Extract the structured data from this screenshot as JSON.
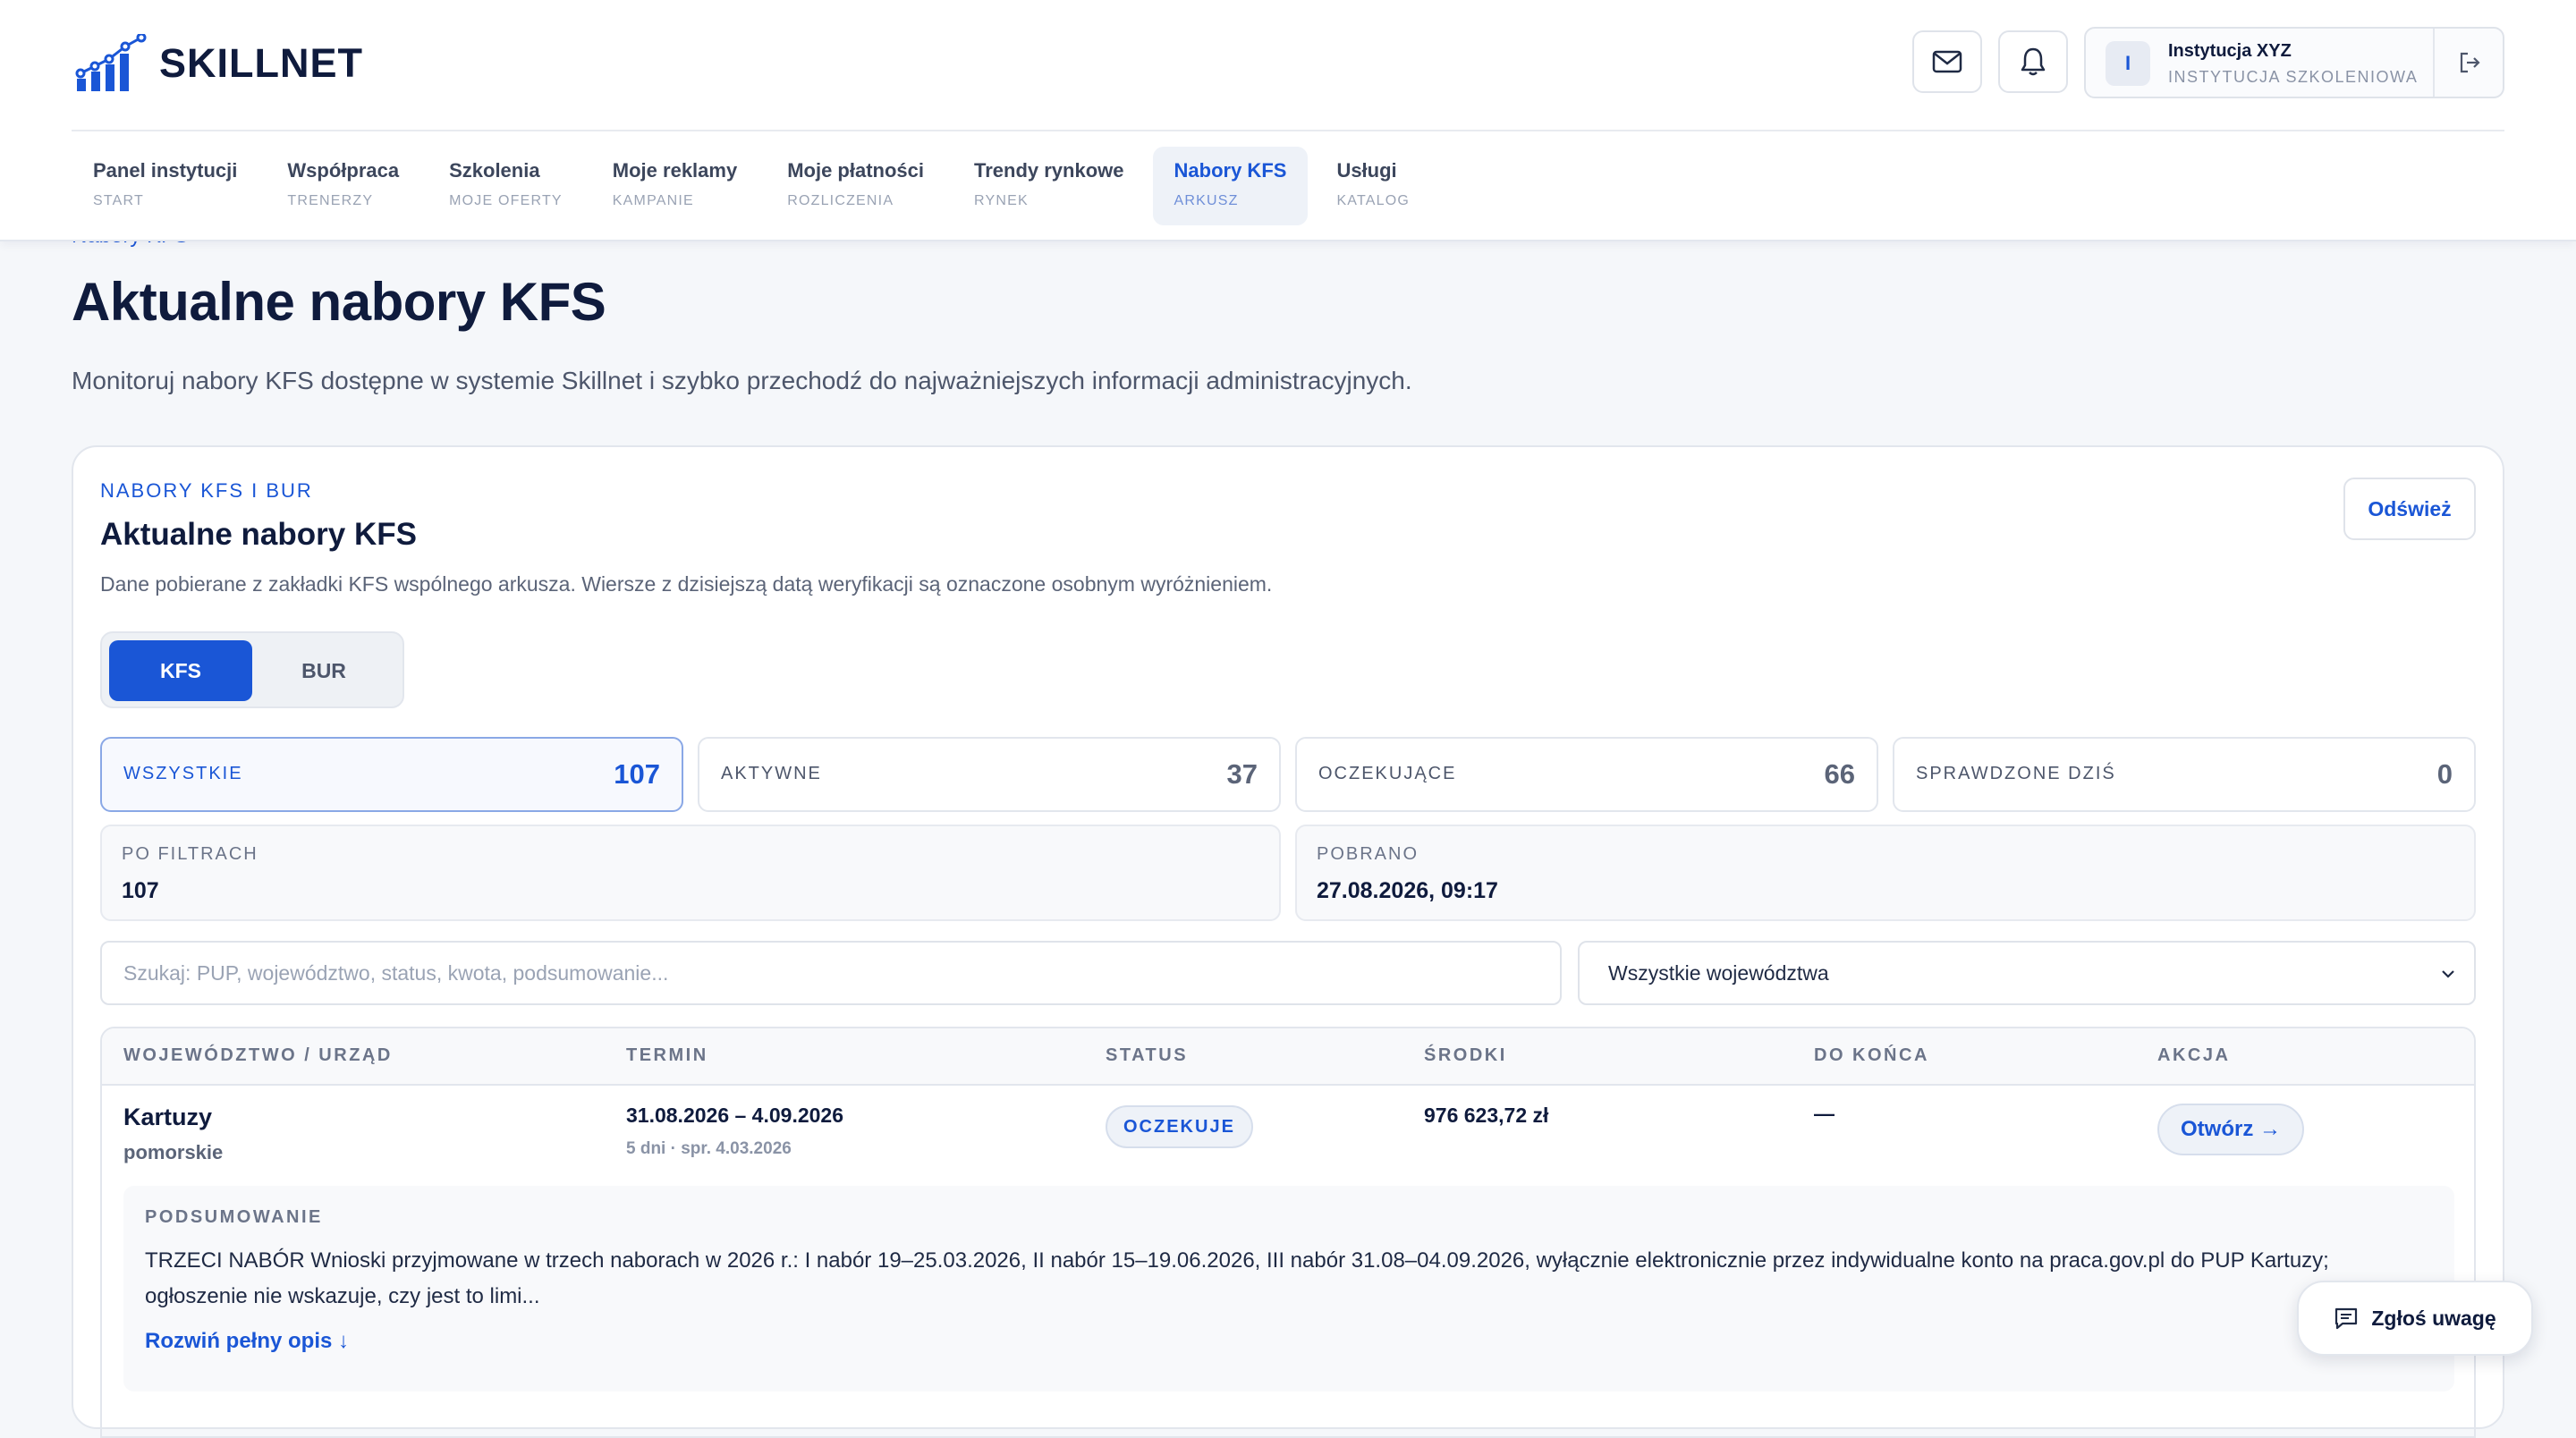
{
  "brand": {
    "name": "SKILLNET",
    "accent": "#1a56d6"
  },
  "header": {
    "icons": [
      "mail-icon",
      "bell-icon",
      "logout-icon"
    ],
    "user": {
      "initial": "I",
      "name": "Instytucja XYZ",
      "role": "INSTYTUCJA SZKOLENIOWA"
    }
  },
  "nav": [
    {
      "label": "Panel instytucji",
      "sub": "START"
    },
    {
      "label": "Współpraca",
      "sub": "TRENERZY"
    },
    {
      "label": "Szkolenia",
      "sub": "MOJE OFERTY"
    },
    {
      "label": "Moje reklamy",
      "sub": "KAMPANIE"
    },
    {
      "label": "Moje płatności",
      "sub": "ROZLICZENIA"
    },
    {
      "label": "Trendy rynkowe",
      "sub": "RYNEK"
    },
    {
      "label": "Nabory KFS",
      "sub": "ARKUSZ",
      "active": true
    },
    {
      "label": "Usługi",
      "sub": "KATALOG"
    }
  ],
  "page": {
    "breadcrumb": "Nabory KFS",
    "title": "Aktualne nabory KFS",
    "subtitle": "Monitoruj nabory KFS dostępne w systemie Skillnet i szybko przechodź do najważniejszych informacji administracyjnych."
  },
  "card": {
    "eyebrow": "NABORY KFS I BUR",
    "title": "Aktualne nabory KFS",
    "description": "Dane pobierane z zakładki KFS wspólnego arkusza. Wiersze z dzisiejszą datą weryfikacji są oznaczone osobnym wyróżnieniem.",
    "refresh_label": "Odśwież",
    "segments": [
      "KFS",
      "BUR"
    ],
    "active_segment": "KFS"
  },
  "stats": [
    {
      "label": "WSZYSTKIE",
      "value": "107",
      "selected": true
    },
    {
      "label": "AKTYWNE",
      "value": "37"
    },
    {
      "label": "OCZEKUJĄCE",
      "value": "66"
    },
    {
      "label": "SPRAWDZONE DZIŚ",
      "value": "0"
    }
  ],
  "info": [
    {
      "label": "PO FILTRACH",
      "value": "107"
    },
    {
      "label": "POBRANO",
      "value": "27.08.2026, 09:17"
    }
  ],
  "filters": {
    "search_placeholder": "Szukaj: PUP, województwo, status, kwota, podsumowanie...",
    "region_selected": "Wszystkie województwa"
  },
  "table": {
    "columns": [
      "WOJEWÓDZTWO / URZĄD",
      "TERMIN",
      "STATUS",
      "ŚRODKI",
      "DO KOŃCA",
      "AKCJA"
    ],
    "rows": [
      {
        "office": "Kartuzy",
        "region": "pomorskie",
        "term": "31.08.2026 – 4.09.2026",
        "term_note": "5 dni · spr. 4.03.2026",
        "status": "OCZEKUJE",
        "funds": "976 623,72 zł",
        "remaining": "—",
        "action": "Otwórz →",
        "summary_label": "PODSUMOWANIE",
        "summary": "TRZECI NABÓR Wnioski przyjmowane w trzech naborach w 2026 r.: I nabór 19–25.03.2026, II nabór 15–19.06.2026, III nabór 31.08–04.09.2026, wyłącznie elektronicznie przez indywidualne konto na praca.gov.pl do PUP Kartuzy; ogłoszenie nie wskazuje, czy jest to limi...",
        "expand": "Rozwiń pełny opis ↓"
      }
    ]
  },
  "feedback_label": "Zgłoś uwagę"
}
